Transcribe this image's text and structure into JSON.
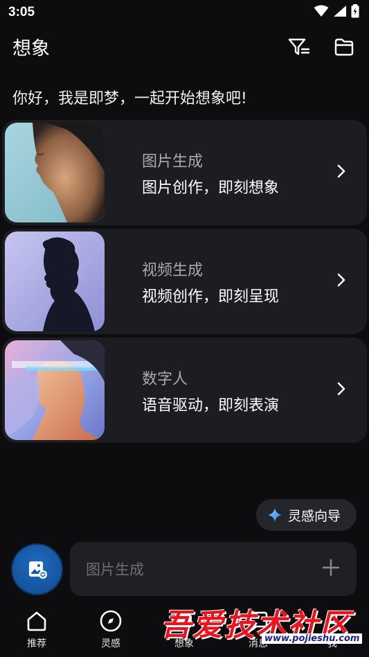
{
  "status_bar": {
    "time": "3:05"
  },
  "header": {
    "title": "想象",
    "icons": [
      "filter-icon",
      "folder-icon"
    ]
  },
  "greeting": "你好，我是即梦，一起开始想象吧!",
  "cards": [
    {
      "title": "图片生成",
      "subtitle": "图片创作，即刻想象"
    },
    {
      "title": "视频生成",
      "subtitle": "视频创作，即刻呈现"
    },
    {
      "title": "数字人",
      "subtitle": "语音驱动，即刻表演"
    }
  ],
  "inspiration": {
    "label": "灵感向导"
  },
  "prompt": {
    "placeholder": "图片生成"
  },
  "nav": [
    {
      "label": "推荐",
      "icon": "home-icon"
    },
    {
      "label": "灵感",
      "icon": "compass-icon"
    },
    {
      "label": "想象",
      "icon": "imagine-icon"
    },
    {
      "label": "消息",
      "icon": "message-icon"
    },
    {
      "label": "我",
      "icon": "profile-icon"
    }
  ],
  "watermark": {
    "text": "吾爱技术社区",
    "url": "www.pojieshu.com"
  },
  "colors": {
    "background": "#0d0d0f",
    "card": "#1c1d21",
    "accent": "#1f6bc2",
    "watermark": "#e8141f"
  }
}
